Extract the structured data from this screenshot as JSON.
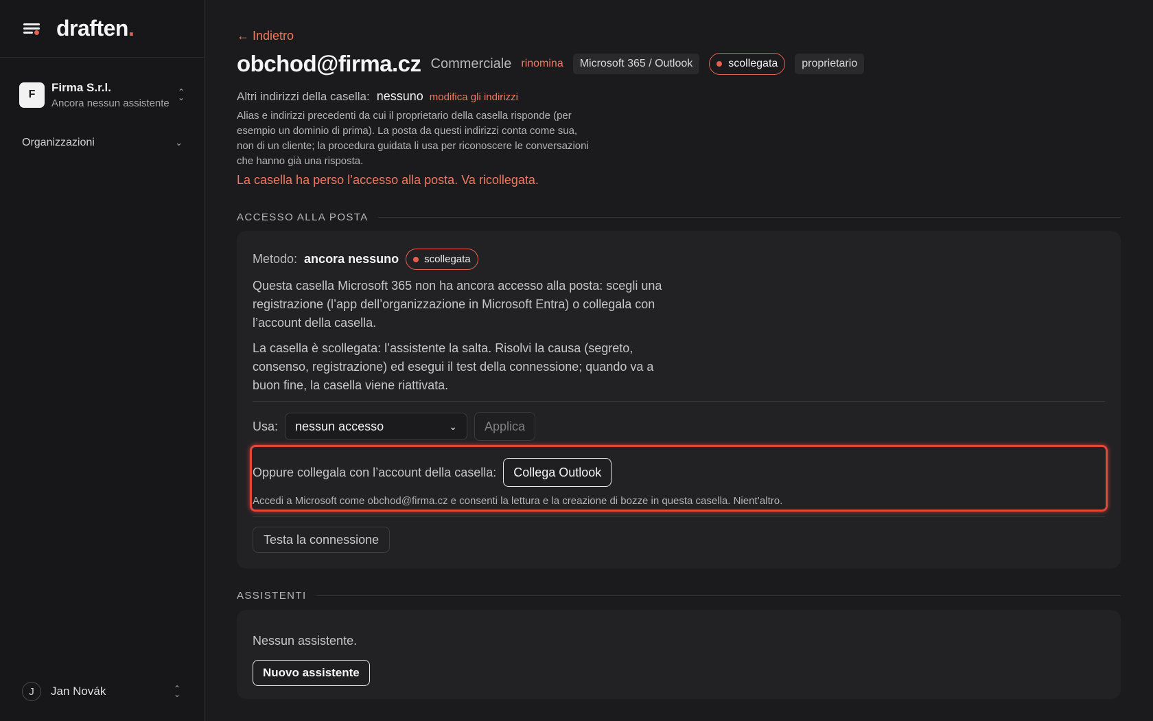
{
  "brand": {
    "name": "draften",
    "dot": "."
  },
  "sidebar": {
    "org": {
      "initial": "F",
      "name": "Firma S.r.l.",
      "subtitle": "Ancora nessun assistente"
    },
    "nav": {
      "organizations_label": "Organizzazioni"
    },
    "user": {
      "initial": "J",
      "name": "Jan Novák"
    }
  },
  "header": {
    "back_label": "← Indietro",
    "title": "obchod@firma.cz",
    "subtitle": "Commerciale",
    "rename_label": "rinomina",
    "provider_tag": "Microsoft 365 / Outlook",
    "status_label": "scollegata",
    "role_tag": "proprietario"
  },
  "addresses": {
    "label": "Altri indirizzi della casella:",
    "value": "nessuno",
    "edit_link": "modifica gli indirizzi",
    "description": "Alias e indirizzi precedenti da cui il proprietario della casella risponde (per esempio un dominio di prima). La posta da questi indirizzi conta come sua, non di un cliente; la procedura guidata li usa per riconoscere le conversazioni che hanno già una risposta."
  },
  "warning": "La casella ha perso l’accesso alla posta. Va ricollegata.",
  "mail_access": {
    "section_title": "ACCESSO ALLA POSTA",
    "method_label": "Metodo:",
    "method_value": "ancora nessuno",
    "status_label": "scollegata",
    "paragraph1": "Questa casella Microsoft 365 non ha ancora accesso alla posta: scegli una registrazione (l’app dell’organizzazione in Microsoft Entra) o collegala con l’account della casella.",
    "paragraph2": "La casella è scollegata: l’assistente la salta. Risolvi la causa (segreto, consenso, registrazione) ed esegui il test della connessione; quando va a buon fine, la casella viene riattivata.",
    "use_label": "Usa:",
    "select_value": "nessun accesso",
    "apply_label": "Applica",
    "oauth_label": "Oppure collegala con l’account della casella:",
    "oauth_button": "Collega Outlook",
    "oauth_note": "Accedi a Microsoft come obchod@firma.cz e consenti la lettura e la creazione di bozze in questa casella. Nient’altro.",
    "test_label": "Testa la connessione"
  },
  "assistants": {
    "section_title": "ASSISTENTI",
    "empty_text": "Nessun assistente.",
    "new_button": "Nuovo assistente"
  },
  "colors": {
    "accent": "#e5604e",
    "link": "#ee7a62",
    "background": "#1b1b1d",
    "card": "#222225"
  }
}
